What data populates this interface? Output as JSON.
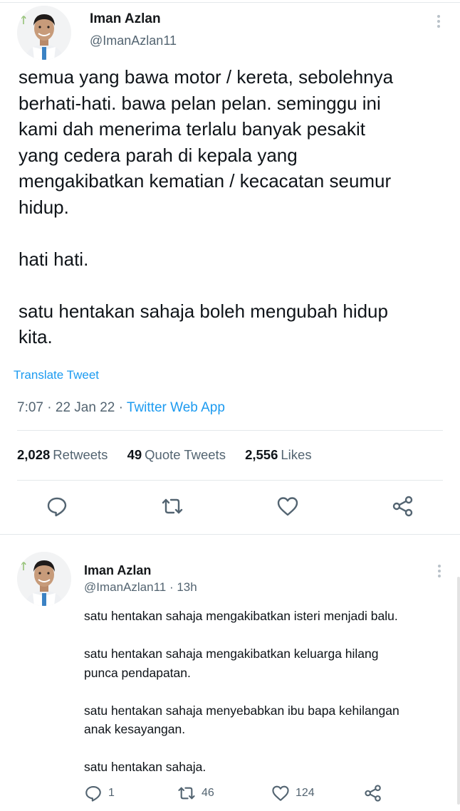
{
  "main_tweet": {
    "author_name": "Iman Azlan",
    "author_handle": "@ImanAzlan11",
    "paragraphs": [
      "semua yang bawa motor / kereta, sebolehnya\nberhati-hati. bawa pelan pelan. seminggu ini\nkami dah menerima terlalu banyak pesakit\nyang cedera parah di kepala yang\nmengakibatkan kematian / kecacatan seumur\nhidup.",
      "hati hati.",
      "satu hentakan sahaja boleh mengubah hidup\nkita."
    ],
    "translate_label": "Translate Tweet",
    "time": "7:07",
    "date": "22 Jan 22",
    "source": "Twitter Web App",
    "stats": {
      "retweets_count": "2,028",
      "retweets_label": "Retweets",
      "quotes_count": "49",
      "quotes_label": "Quote Tweets",
      "likes_count": "2,556",
      "likes_label": "Likes"
    }
  },
  "reply_tweet": {
    "author_name": "Iman Azlan",
    "author_handle": "@ImanAzlan11",
    "age": "13h",
    "paragraphs": [
      "satu hentakan sahaja mengakibatkan isteri menjadi balu.",
      " satu hentakan sahaja mengakibatkan keluarga hilang\npunca pendapatan.",
      "satu hentakan sahaja menyebabkan ibu bapa kehilangan\nanak kesayangan.",
      "satu hentakan sahaja."
    ],
    "actions": {
      "reply_count": "1",
      "retweet_count": "46",
      "like_count": "124"
    }
  },
  "icons": {
    "reply": "reply-icon",
    "retweet": "retweet-icon",
    "like": "heart-icon",
    "share": "share-icon",
    "more": "more-vertical-icon"
  },
  "colors": {
    "link": "#1d9bf0",
    "secondary_text": "#536471",
    "icon_gray": "#536471",
    "divider": "#e4e8eb"
  }
}
